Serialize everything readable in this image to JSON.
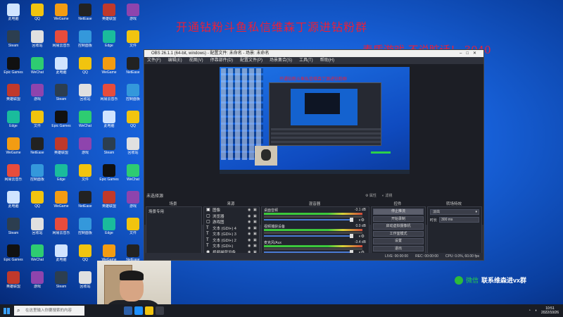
{
  "overlay": {
    "title": "开通钻粉斗鱼私信维森丁源进钻粉群",
    "subtitle": "素质游戏 不说脏话！ 3040",
    "wechat_green": "微信",
    "wechat_white": "联系维森进vx群"
  },
  "desktop_icons": [
    {
      "label": "此电脑",
      "color": "#d0e4ff"
    },
    {
      "label": "QQ",
      "color": "#f1c40f"
    },
    {
      "label": "WeGame",
      "color": "#f39c12"
    },
    {
      "label": "NetEase",
      "color": "#222222"
    },
    {
      "label": "英雄联盟",
      "color": "#c0392b"
    },
    {
      "label": "游戏",
      "color": "#8e44ad"
    },
    {
      "label": "Steam",
      "color": "#2c3e50"
    },
    {
      "label": "回收站",
      "color": "#e0e0e0"
    },
    {
      "label": "网易云音乐",
      "color": "#e74c3c"
    },
    {
      "label": "控制面板",
      "color": "#3498db"
    },
    {
      "label": "Edge",
      "color": "#1abc9c"
    },
    {
      "label": "文件",
      "color": "#f1c40f"
    },
    {
      "label": "Epic Games",
      "color": "#111111"
    },
    {
      "label": "WeChat",
      "color": "#2ecc71"
    }
  ],
  "obs": {
    "title": "OBS 26.1.1 (64-bit, windows) - 配置文件: 未命名 - 场景: 未命名",
    "menu": [
      "文件(F)",
      "编辑(E)",
      "视图(V)",
      "停靠部件(D)",
      "配置文件(P)",
      "场景集合(S)",
      "工具(T)",
      "帮助(H)"
    ],
    "scene_label": "未选择源",
    "props_label": "属性",
    "filters_label": "滤镜",
    "dock_titles": [
      "场景",
      "来源",
      "混音器",
      "控件",
      "转场特效"
    ],
    "scenes": [
      "场景专用"
    ],
    "sources": [
      {
        "icon": "▣",
        "name": "图像"
      },
      {
        "icon": "▢",
        "name": "浏览器"
      },
      {
        "icon": "▢",
        "name": "游戏图"
      },
      {
        "icon": "T",
        "name": "文本 (GDI+) 4"
      },
      {
        "icon": "T",
        "name": "文本 (GDI+) 3"
      },
      {
        "icon": "T",
        "name": "文本 (GDI+) 2"
      },
      {
        "icon": "T",
        "name": "文本 (GDI+)"
      },
      {
        "icon": "◉",
        "name": "视频捕获设备"
      }
    ],
    "mixer": [
      {
        "name": "桌面音频",
        "db": "-3.1 dB"
      },
      {
        "name": "视频捕获设备",
        "db": "0.0 dB"
      },
      {
        "name": "麦克风/Aux",
        "db": "-3.4 dB"
      }
    ],
    "controls": [
      "停止推流",
      "开始录制",
      "启动虚拟摄像机",
      "工作室模式",
      "设置",
      "退出"
    ],
    "transition": {
      "type": "淡出",
      "duration_label": "时长",
      "duration": "300 ms"
    },
    "status": [
      "LIVE: 00:00:00",
      "REC: 00:00:00",
      "CPU: 0.0%, 60.00 fps"
    ]
  },
  "taskbar": {
    "search_placeholder": "在这里输入你要搜索的内容",
    "time": "10:51",
    "date": "2022/10/26"
  }
}
